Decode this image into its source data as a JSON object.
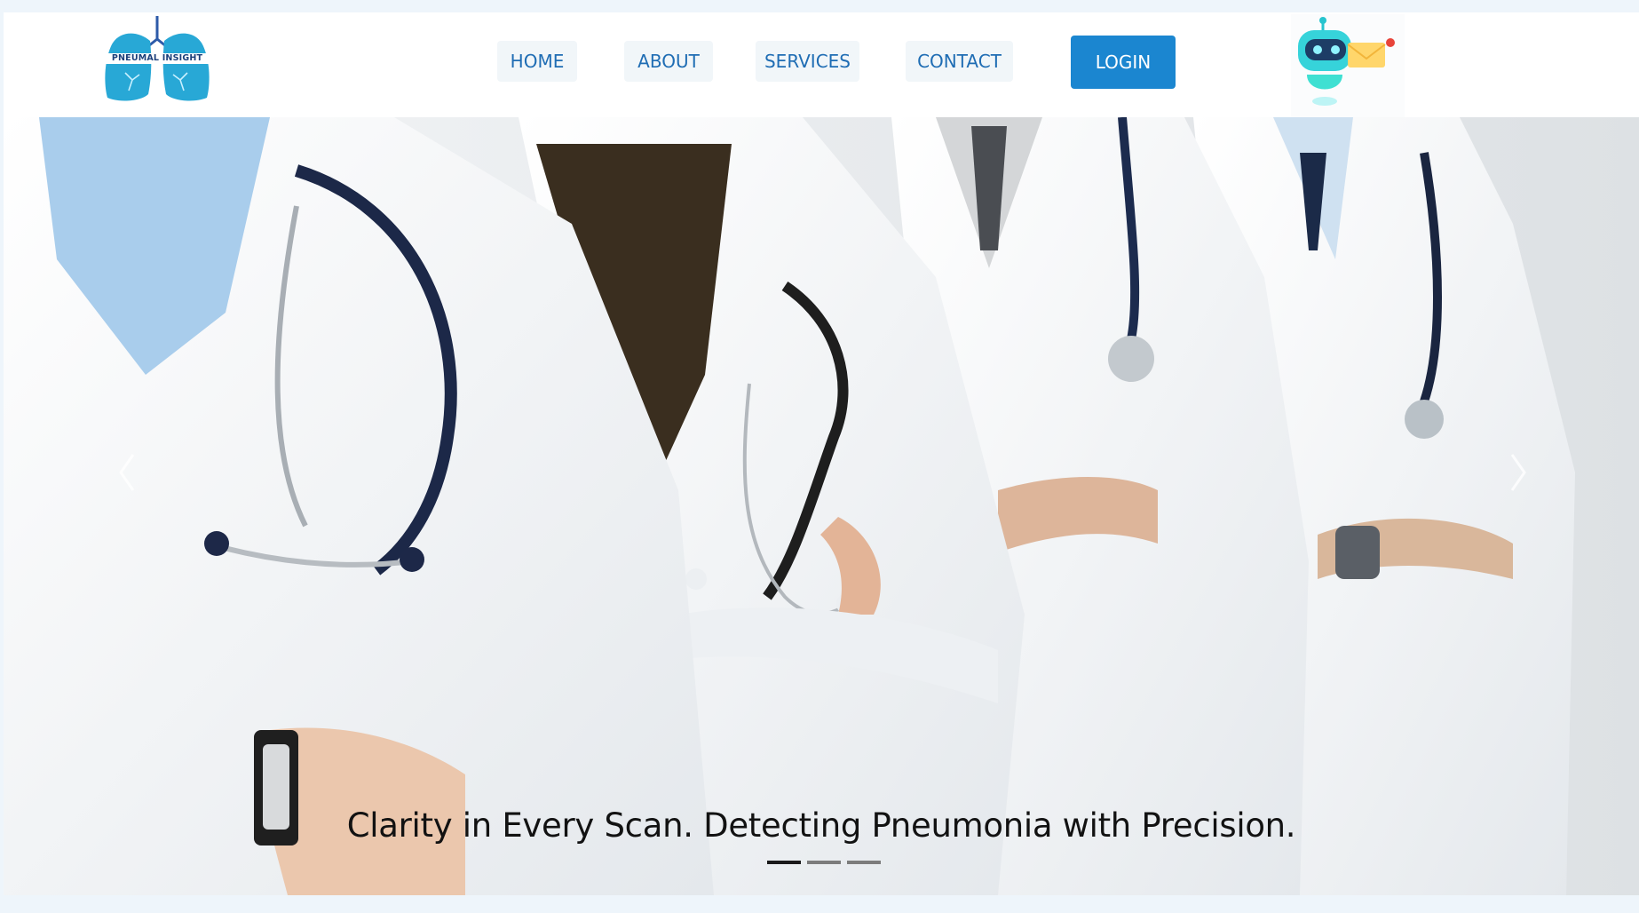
{
  "brand": {
    "logo_text": "PNEUMAL INSIGHT",
    "color": "#1b3f7a",
    "accent": "#2aa7d6"
  },
  "nav": {
    "items": [
      {
        "label": "HOME"
      },
      {
        "label": "ABOUT"
      },
      {
        "label": "SERVICES"
      },
      {
        "label": "CONTACT"
      }
    ],
    "login_label": "LOGIN",
    "login_color": "#1b86d0",
    "link_color": "#1f6db4"
  },
  "chatbot": {
    "icon": "chatbot-robot-icon"
  },
  "hero": {
    "image": "doctors-in-white-coats-photo",
    "caption": "Clarity in Every Scan. Detecting Pneumonia with Precision.",
    "prev_icon": "chevron-left-icon",
    "next_icon": "chevron-right-icon",
    "slides": 3,
    "active_slide": 1
  }
}
